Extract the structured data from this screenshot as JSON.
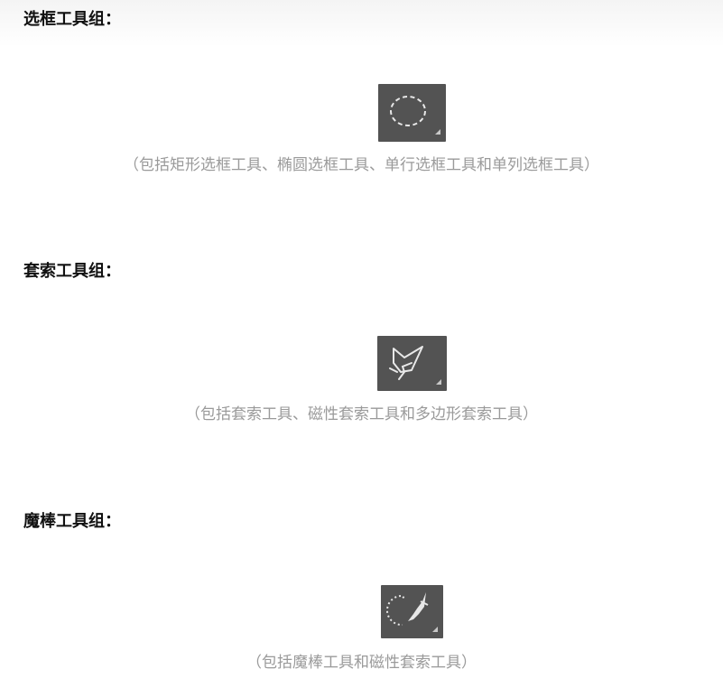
{
  "sections": [
    {
      "heading": "选框工具组：",
      "icon": "elliptical-marquee-icon",
      "caption": "（包括矩形选框工具、椭圆选框工具、单行选框工具和单列选框工具）"
    },
    {
      "heading": "套索工具组：",
      "icon": "lasso-icon",
      "caption": "（包括套索工具、磁性套索工具和多边形套索工具）"
    },
    {
      "heading": "魔棒工具组：",
      "icon": "magic-wand-icon",
      "caption": "（包括魔棒工具和磁性套索工具）"
    }
  ],
  "colors": {
    "icon_background": "#535353",
    "icon_stroke": "#e8e8e8",
    "caption_text": "#9a9a9a",
    "heading_text": "#111111"
  }
}
